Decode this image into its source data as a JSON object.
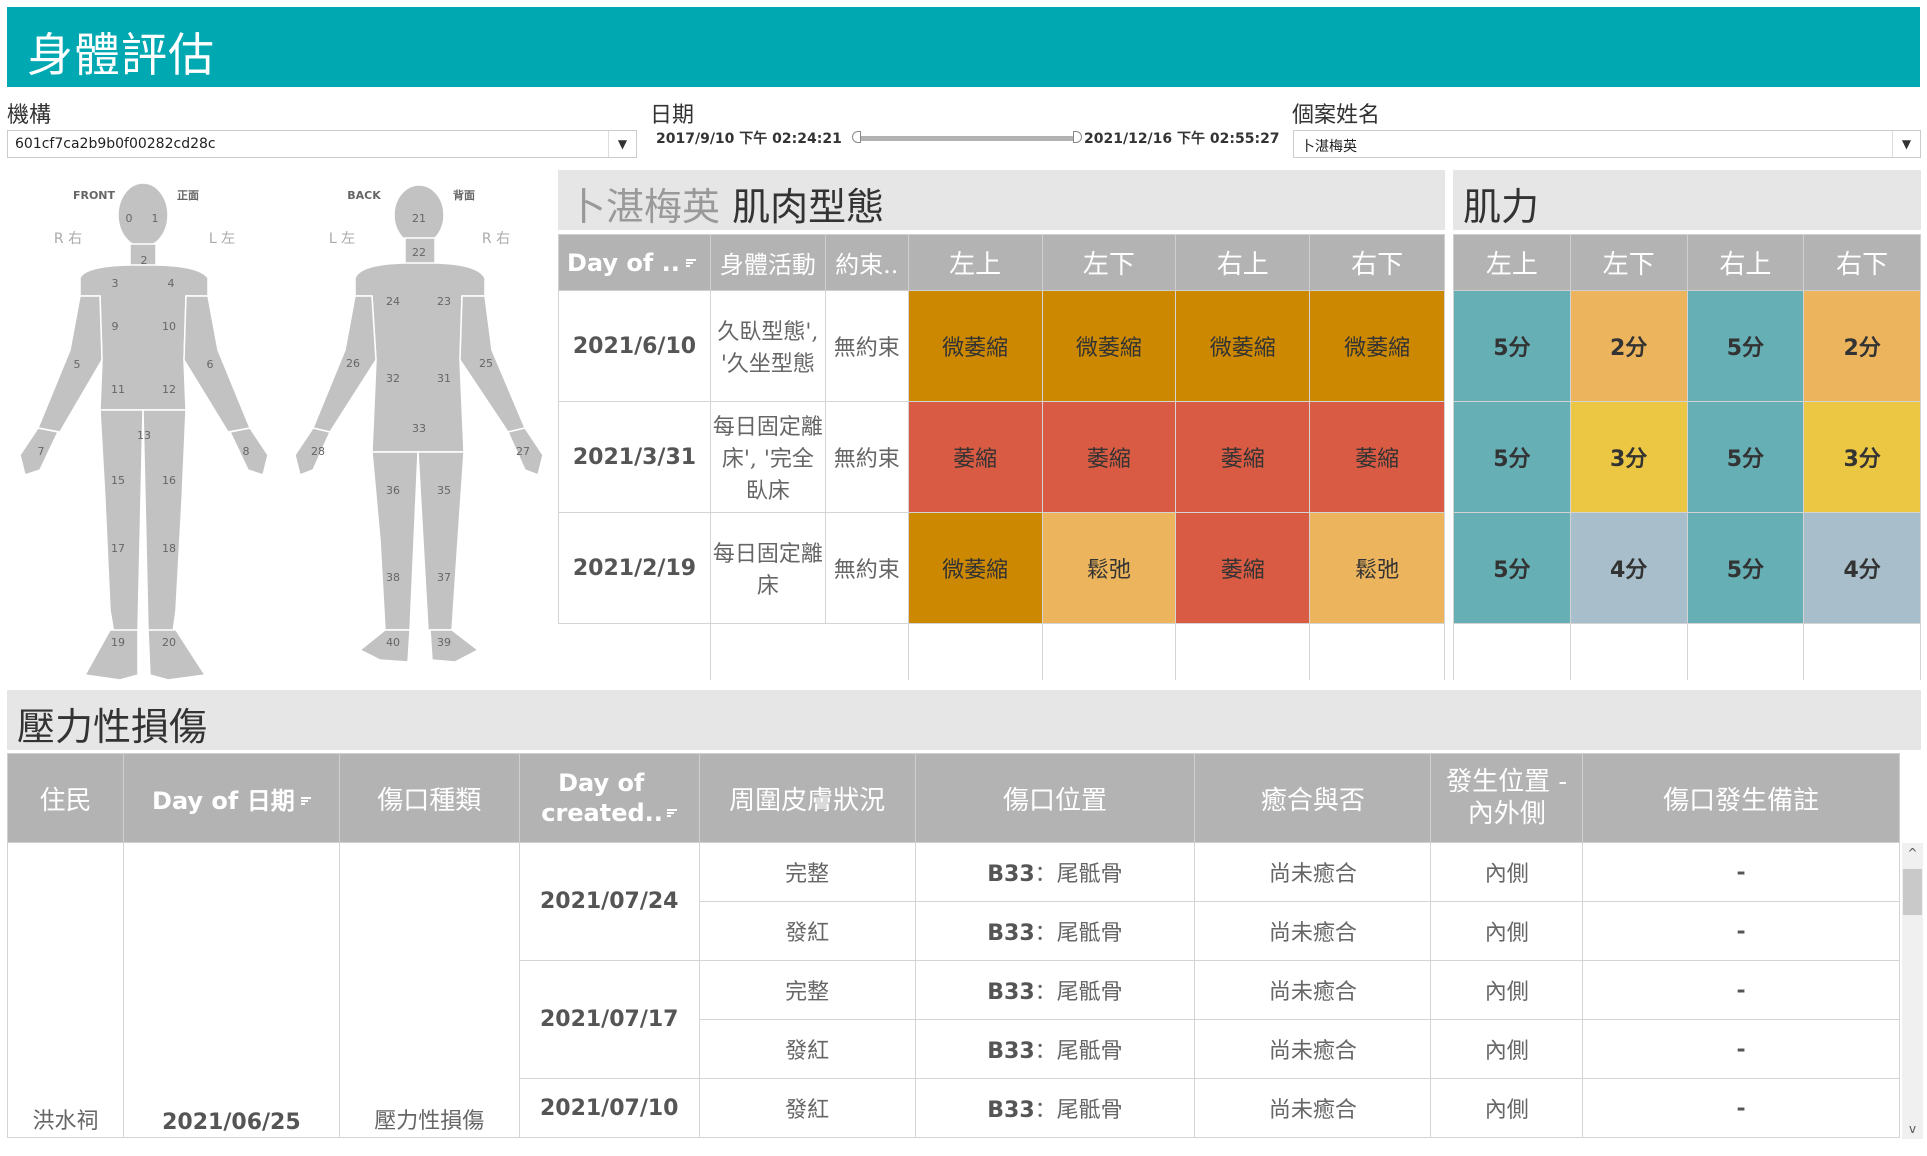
{
  "header": {
    "title": "身體評估"
  },
  "filters": {
    "org_label": "機構",
    "org_value": "601cf7ca2b9b0f00282cd28c",
    "date_label": "日期",
    "date_start": "2017/9/10 下午 02:24:21",
    "date_end": "2021/12/16 下午 02:55:27",
    "name_label": "個案姓名",
    "name_value": "卜湛梅英"
  },
  "body_map": {
    "front": {
      "title_en": "FRONT",
      "title_zh": "正面",
      "left_label": "R 右",
      "right_label": "L 左",
      "regions": [
        "0",
        "1",
        "2",
        "3",
        "4",
        "5",
        "6",
        "7",
        "8",
        "9",
        "10",
        "11",
        "12",
        "13",
        "15",
        "16",
        "17",
        "18",
        "19",
        "20"
      ]
    },
    "back": {
      "title_en": "BACK",
      "title_zh": "背面",
      "left_label": "L 左",
      "right_label": "R 右",
      "regions": [
        "21",
        "22",
        "23",
        "24",
        "25",
        "26",
        "27",
        "28",
        "31",
        "32",
        "33",
        "35",
        "36",
        "37",
        "38",
        "39",
        "40"
      ]
    }
  },
  "muscle_panel": {
    "person": "卜湛梅英",
    "title": "肌肉型態",
    "columns": [
      "Day of ..",
      "身體活動",
      "約束..",
      "左上",
      "左下",
      "右上",
      "右下"
    ],
    "rows": [
      {
        "date": "2021/6/10",
        "activity": "久臥型態', '久坐型態",
        "restraint": "無約束",
        "cells": [
          "微萎縮",
          "微萎縮",
          "微萎縮",
          "微萎縮"
        ],
        "colors": [
          "#cc8800",
          "#cc8800",
          "#cc8800",
          "#cc8800"
        ]
      },
      {
        "date": "2021/3/31",
        "activity": "每日固定離床', '完全臥床",
        "restraint": "無約束",
        "cells": [
          "萎縮",
          "萎縮",
          "萎縮",
          "萎縮"
        ],
        "colors": [
          "#d95b43",
          "#d95b43",
          "#d95b43",
          "#d95b43"
        ]
      },
      {
        "date": "2021/2/19",
        "activity": "每日固定離床",
        "restraint": "無約束",
        "cells": [
          "微萎縮",
          "鬆弛",
          "萎縮",
          "鬆弛"
        ],
        "colors": [
          "#cc8800",
          "#ecb55d",
          "#d95b43",
          "#ecb55d"
        ]
      }
    ]
  },
  "strength_panel": {
    "title": "肌力",
    "columns": [
      "左上",
      "左下",
      "右上",
      "右下"
    ],
    "rows": [
      {
        "cells": [
          "5分",
          "2分",
          "5分",
          "2分"
        ],
        "colors": [
          "#65afb5",
          "#ecb55d",
          "#65afb5",
          "#ecb55d"
        ]
      },
      {
        "cells": [
          "5分",
          "3分",
          "5分",
          "3分"
        ],
        "colors": [
          "#65afb5",
          "#ecc744",
          "#65afb5",
          "#ecc744"
        ]
      },
      {
        "cells": [
          "5分",
          "4分",
          "5分",
          "4分"
        ],
        "colors": [
          "#65afb5",
          "#a8bfcb",
          "#65afb5",
          "#a8bfcb"
        ]
      }
    ]
  },
  "pressure_panel": {
    "title": "壓力性損傷",
    "columns": [
      "住民",
      "Day of 日期",
      "傷口種類",
      "Day of created..",
      "周圍皮膚狀況",
      "傷口位置",
      "癒合與否",
      "發生位置 - 內外側",
      "傷口發生備註"
    ],
    "resident": "洪水祠",
    "date": "2021/06/25",
    "wound_type": "壓力性損傷",
    "groups": [
      {
        "created": "2021/07/24",
        "rows": [
          {
            "skin": "完整",
            "location_code": "B33",
            "location_name": "：尾骶骨",
            "healed": "尚未癒合",
            "side": "內側",
            "note": "-"
          },
          {
            "skin": "發紅",
            "location_code": "B33",
            "location_name": "：尾骶骨",
            "healed": "尚未癒合",
            "side": "內側",
            "note": "-"
          }
        ]
      },
      {
        "created": "2021/07/17",
        "rows": [
          {
            "skin": "完整",
            "location_code": "B33",
            "location_name": "：尾骶骨",
            "healed": "尚未癒合",
            "side": "內側",
            "note": "-"
          },
          {
            "skin": "發紅",
            "location_code": "B33",
            "location_name": "：尾骶骨",
            "healed": "尚未癒合",
            "side": "內側",
            "note": "-"
          }
        ]
      },
      {
        "created": "2021/07/10",
        "rows": [
          {
            "skin": "發紅",
            "location_code": "B33",
            "location_name": "：尾骶骨",
            "healed": "尚未癒合",
            "side": "內側",
            "note": "-"
          }
        ]
      }
    ]
  },
  "scrollbar": {
    "up_icon": "^",
    "down_icon": "v"
  }
}
